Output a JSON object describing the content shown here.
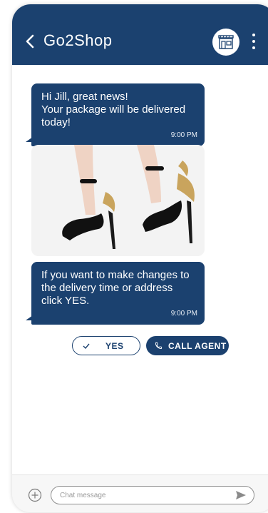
{
  "header": {
    "title": "Go2Shop",
    "icons": {
      "back": "chevron-left-icon",
      "avatar": "store-icon",
      "menu": "more-vertical-icon"
    }
  },
  "messages": [
    {
      "text": "Hi Jill, great news!\nYour package will be delivered today!",
      "time": "9:00 PM"
    },
    {
      "image": "black-heeled-sandals-photo"
    },
    {
      "text": "If you want to make changes to the delivery time or address click YES.",
      "time": "9:00 PM"
    }
  ],
  "suggestions": [
    {
      "label": "YES",
      "icon": "check-icon"
    },
    {
      "label": "CALL AGENT",
      "icon": "phone-icon"
    }
  ],
  "composer": {
    "placeholder": "Chat message",
    "icons": {
      "add": "add-circle-icon",
      "send": "send-icon"
    }
  },
  "colors": {
    "brand": "#1b416f",
    "bubble_text": "#ffffff",
    "background": "#ffffff"
  }
}
